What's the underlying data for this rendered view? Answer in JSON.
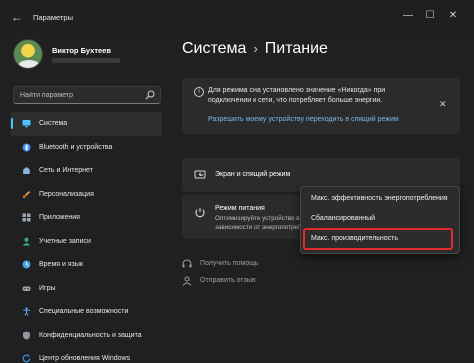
{
  "window": {
    "title": "Параметры",
    "back_glyph": "←",
    "minimize_glyph": "—",
    "maximize_glyph": "☐",
    "close_glyph": "✕"
  },
  "user": {
    "name": "Виктор Бухтеев"
  },
  "search": {
    "placeholder": "Найти параметр",
    "icon": "search-icon"
  },
  "sidebar": {
    "items": [
      {
        "label": "Система",
        "icon": "monitor-icon",
        "color": "#4cc2ff",
        "active": true
      },
      {
        "label": "Bluetooth и устройства",
        "icon": "bluetooth-icon",
        "color": "#3b8eea",
        "active": false
      },
      {
        "label": "Сеть и Интернет",
        "icon": "wifi-icon",
        "color": "#8ab4d8",
        "active": false
      },
      {
        "label": "Персонализация",
        "icon": "brush-icon",
        "color": "#e3a24a",
        "active": false
      },
      {
        "label": "Приложения",
        "icon": "apps-icon",
        "color": "#9aa7b5",
        "active": false
      },
      {
        "label": "Учетные записи",
        "icon": "person-icon",
        "color": "#39b07a",
        "active": false
      },
      {
        "label": "Время и язык",
        "icon": "globe-clock-icon",
        "color": "#4aa3df",
        "active": false
      },
      {
        "label": "Игры",
        "icon": "gamepad-icon",
        "color": "#a0a0a0",
        "active": false
      },
      {
        "label": "Специальные возможности",
        "icon": "accessibility-icon",
        "color": "#5aa0e6",
        "active": false
      },
      {
        "label": "Конфиденциальность и защита",
        "icon": "shield-icon",
        "color": "#8f99a3",
        "active": false
      },
      {
        "label": "Центр обновления Windows",
        "icon": "update-icon",
        "color": "#3b8eea",
        "active": false
      }
    ]
  },
  "breadcrumb": {
    "parent": "Система",
    "separator": "›",
    "current": "Питание"
  },
  "banner": {
    "text": "Для режима сна установлено значение «Никогда» при подключении к сети, что потребляет больше энергии.",
    "link": "Разрешить моему устройству переходить в спящий режим",
    "info_glyph": "i",
    "close_glyph": "✕"
  },
  "screen_sleep": {
    "title": "Экран и спящий режим",
    "chevron": "⌄"
  },
  "power_mode": {
    "title": "Режим питания",
    "description": "Оптимизируйте устройство в зависимости от энергопотребления и производительности"
  },
  "dropdown": {
    "options": [
      "Макс. эффективность энергопотребления",
      "Сбалансированный",
      "Макс. производительность"
    ]
  },
  "help": {
    "get_help": "Получить помощь",
    "feedback": "Отправить отзыв"
  },
  "colors": {
    "accent": "#4cc2ff",
    "highlight": "#e12a2a",
    "link": "#7fb7e2"
  }
}
